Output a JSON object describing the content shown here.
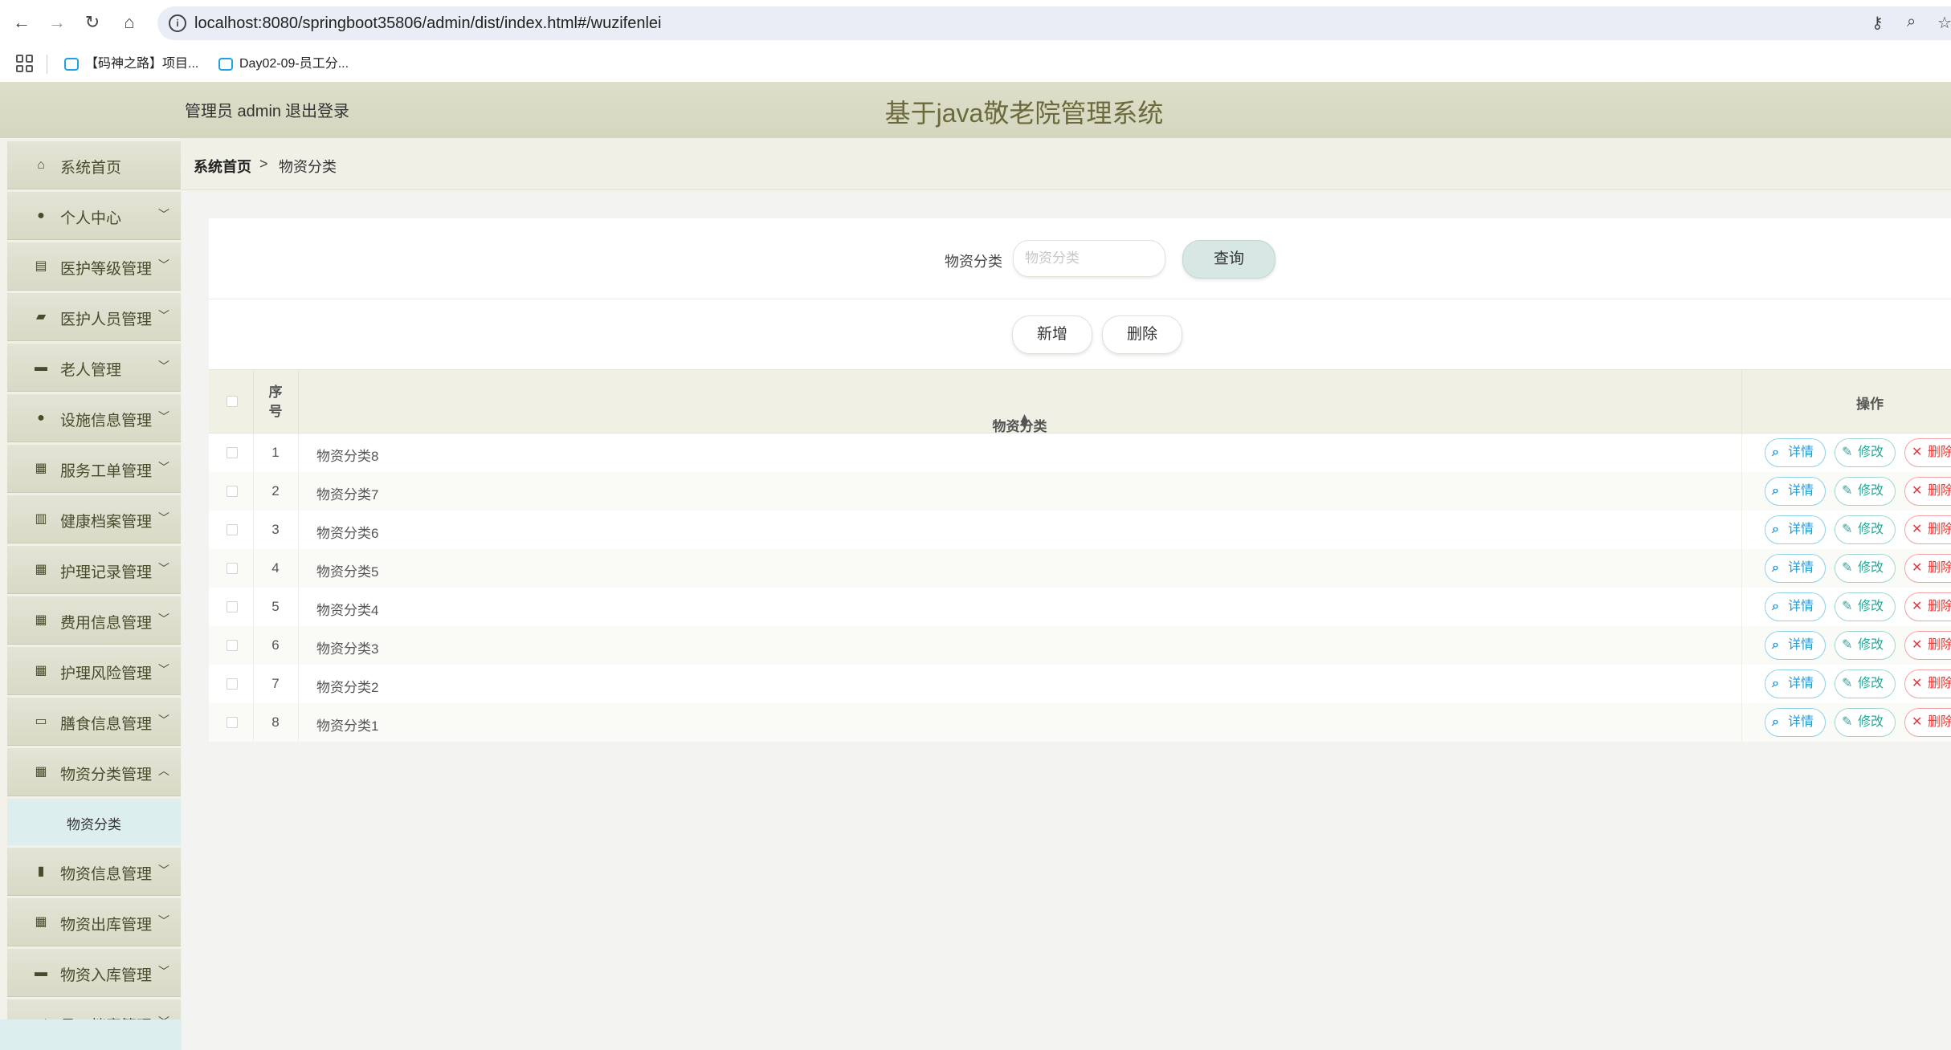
{
  "browser": {
    "url": "localhost:8080/springboot35806/admin/dist/index.html#/wuzifenlei",
    "bookmarks": [
      "【码神之路】项目...",
      "Day02-09-员工分..."
    ]
  },
  "header": {
    "user": "管理员 admin",
    "logout": "退出登录",
    "title": "基于java敬老院管理系统"
  },
  "sidebar": {
    "items": [
      {
        "label": "系统首页",
        "icon": "home-icon"
      },
      {
        "label": "个人中心",
        "icon": "user-icon"
      },
      {
        "label": "医护等级管理",
        "icon": "clipboard-icon"
      },
      {
        "label": "医护人员管理",
        "icon": "briefcase-icon"
      },
      {
        "label": "老人管理",
        "icon": "case-icon"
      },
      {
        "label": "设施信息管理",
        "icon": "location-icon"
      },
      {
        "label": "服务工单管理",
        "icon": "grid-icon"
      },
      {
        "label": "健康档案管理",
        "icon": "book-icon"
      },
      {
        "label": "护理记录管理",
        "icon": "grid-icon"
      },
      {
        "label": "费用信息管理",
        "icon": "grid-icon"
      },
      {
        "label": "护理风险管理",
        "icon": "grid-icon"
      },
      {
        "label": "膳食信息管理",
        "icon": "tray-icon"
      },
      {
        "label": "物资分类管理",
        "icon": "grid-icon"
      }
    ],
    "sub_active": "物资分类",
    "items_after": [
      {
        "label": "物资信息管理",
        "icon": "bar-chart-icon"
      },
      {
        "label": "物资出库管理",
        "icon": "grid-icon"
      },
      {
        "label": "物资入库管理",
        "icon": "chat-icon"
      },
      {
        "label": "员工档案管理",
        "icon": "send-icon"
      }
    ]
  },
  "breadcrumb": {
    "home": "系统首页",
    "sep": ">",
    "current": "物资分类"
  },
  "search": {
    "label": "物资分类",
    "placeholder": "物资分类",
    "value": "",
    "button": "查询"
  },
  "actions": {
    "add": "新增",
    "delete": "删除"
  },
  "table": {
    "headers": {
      "index": "序号",
      "name": "物资分类",
      "ops": "操作"
    },
    "rows": [
      {
        "index": "1",
        "name": "物资分类8"
      },
      {
        "index": "2",
        "name": "物资分类7"
      },
      {
        "index": "3",
        "name": "物资分类6"
      },
      {
        "index": "4",
        "name": "物资分类5"
      },
      {
        "index": "5",
        "name": "物资分类4"
      },
      {
        "index": "6",
        "name": "物资分类3"
      },
      {
        "index": "7",
        "name": "物资分类2"
      },
      {
        "index": "8",
        "name": "物资分类1"
      }
    ],
    "row_ops": {
      "detail": "详情",
      "edit": "修改",
      "delete": "删除"
    }
  },
  "colors": {
    "header_bg": "#d9dac3",
    "title": "#6b6a3c",
    "query_btn": "#d6e7e4",
    "sub_menu": "#dceeee"
  }
}
